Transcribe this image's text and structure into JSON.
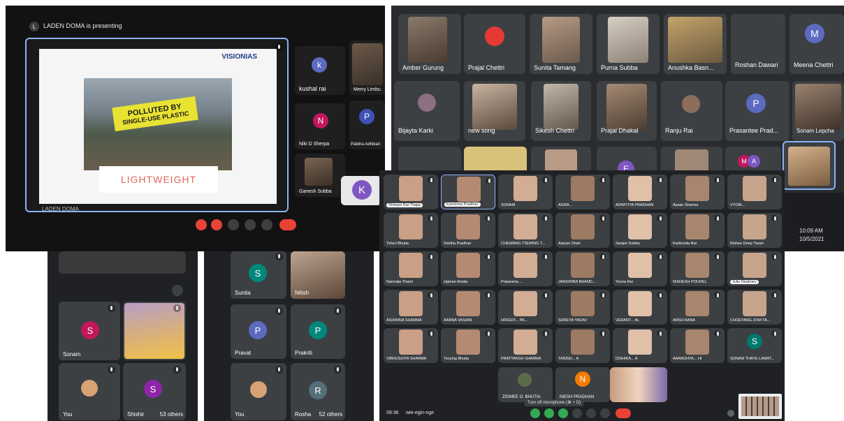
{
  "panel1": {
    "presenter_initial": "L",
    "presenting_text": "LADEN DOMA is presenting",
    "slide_brand": "VISIONIAS",
    "slide_banner_line1": "POLLUTED BY",
    "slide_banner_line2": "SINGLE-USE PLASTIC",
    "slide_word": "LIGHTWEIGHT",
    "footer_name": "LADEN DOMA",
    "participants": [
      {
        "initial": "k",
        "name": "kushal rai"
      },
      {
        "initial": "",
        "name": "Merry Limbu"
      },
      {
        "initial": "N",
        "name": "Niki D Sherpa"
      },
      {
        "initial": "P",
        "name": "Pabitra Adhikari"
      },
      {
        "initial": "",
        "name": "Ganesh Subba"
      },
      {
        "initial": "K",
        "name": ""
      }
    ]
  },
  "panel2": {
    "row1": [
      "Amber Gurung",
      "Prajal Chettri",
      "Sunita Tamang",
      "Purna Subba",
      "Anushka Basn...",
      "Roshan Dawari",
      "Meena Chettri"
    ],
    "row1_initials": {
      "meena": "M"
    },
    "row2": [
      "Bijayta Karki",
      "new song",
      "Sikesh Chettri",
      "Prajal Dhakal",
      "Ranju Rai",
      "Prasantee Prad...",
      "Sonam Lepcha"
    ],
    "row2_initials": {
      "prasantee": "P"
    },
    "row3_initials": [
      "E",
      "M",
      "A"
    ],
    "clock_time": "10:09 AM",
    "clock_date": "10/5/2021"
  },
  "panel3": {
    "tiles": [
      {
        "initial": "S",
        "name": "Sonam"
      },
      {
        "initial": "",
        "name": "..."
      },
      {
        "initial": "",
        "name": "You"
      },
      {
        "initial": "S",
        "name": "Shishir"
      }
    ],
    "others": "53 others"
  },
  "panel4": {
    "tiles": [
      {
        "initial": "S",
        "name": "Sunita"
      },
      {
        "initial": "",
        "name": "Nitish"
      },
      {
        "initial": "P",
        "name": "Pravat"
      },
      {
        "initial": "P",
        "name": "Prakriti"
      },
      {
        "initial": "",
        "name": "You"
      },
      {
        "initial": "R",
        "name": "Rosha"
      }
    ],
    "others": "52 others"
  },
  "panel5": {
    "rows": [
      [
        "Shiwani Rai Thapa",
        "Karishma Pradhan",
        "SONAM",
        "AGRA...",
        "ADWITIYA PRADHAN",
        "Ayaan Sharma",
        "VYOM..."
      ],
      [
        "Tsheri Bhutia",
        "Smitha Pradhan",
        "CHEWANG TSERING T...",
        "Aaryan Shah",
        "Sanjee Subba",
        "Kadensila Rai",
        "Rishee Deep Tiwari"
      ],
      [
        "Namrata Thami",
        "zigmee bhutia",
        "Praweena ...",
        "JANSIRIBA BHAND...",
        "Yozna Rai",
        "NISHESH POUDEL",
        "Julie Narjinary"
      ],
      [
        "ASHWINA SHARMA",
        "AARNA VASHNI",
        "HRIGHT... PA...",
        "SHREYA YADAV",
        "VEDANT... AL",
        "ARSH RANA",
        "CHOEYANG ZOM TA..."
      ],
      [
        "VIBHUSHITA SHARMA",
        "Tenzing Bhutia",
        "PRATYAKSH SHARMA",
        "TANISH... A",
        "DISHIKA... A",
        "AARADHYA... HI",
        "SONAM THAYE LAMAT..."
      ],
      [
        "ZIGMEE O. BHUTIA",
        "NIESH PRADHAN"
      ]
    ],
    "initials": {
      "sonam_thaye": "S",
      "niesh": "N"
    },
    "time": "09:36",
    "meeting_code": "wie-egin-nge",
    "tooltip": "Turn off microphone (⌘ + D)"
  },
  "colors": {
    "meet_dark": "#202124",
    "tile": "#3c4043",
    "accent_blue": "#8ab4f8",
    "end_call_red": "#ea4335",
    "purple": "#7b3fa8",
    "pink": "#c2185b",
    "teal": "#00897b",
    "indigo": "#5c6bc0",
    "orange": "#f57c00",
    "green_btn": "#34a853"
  }
}
